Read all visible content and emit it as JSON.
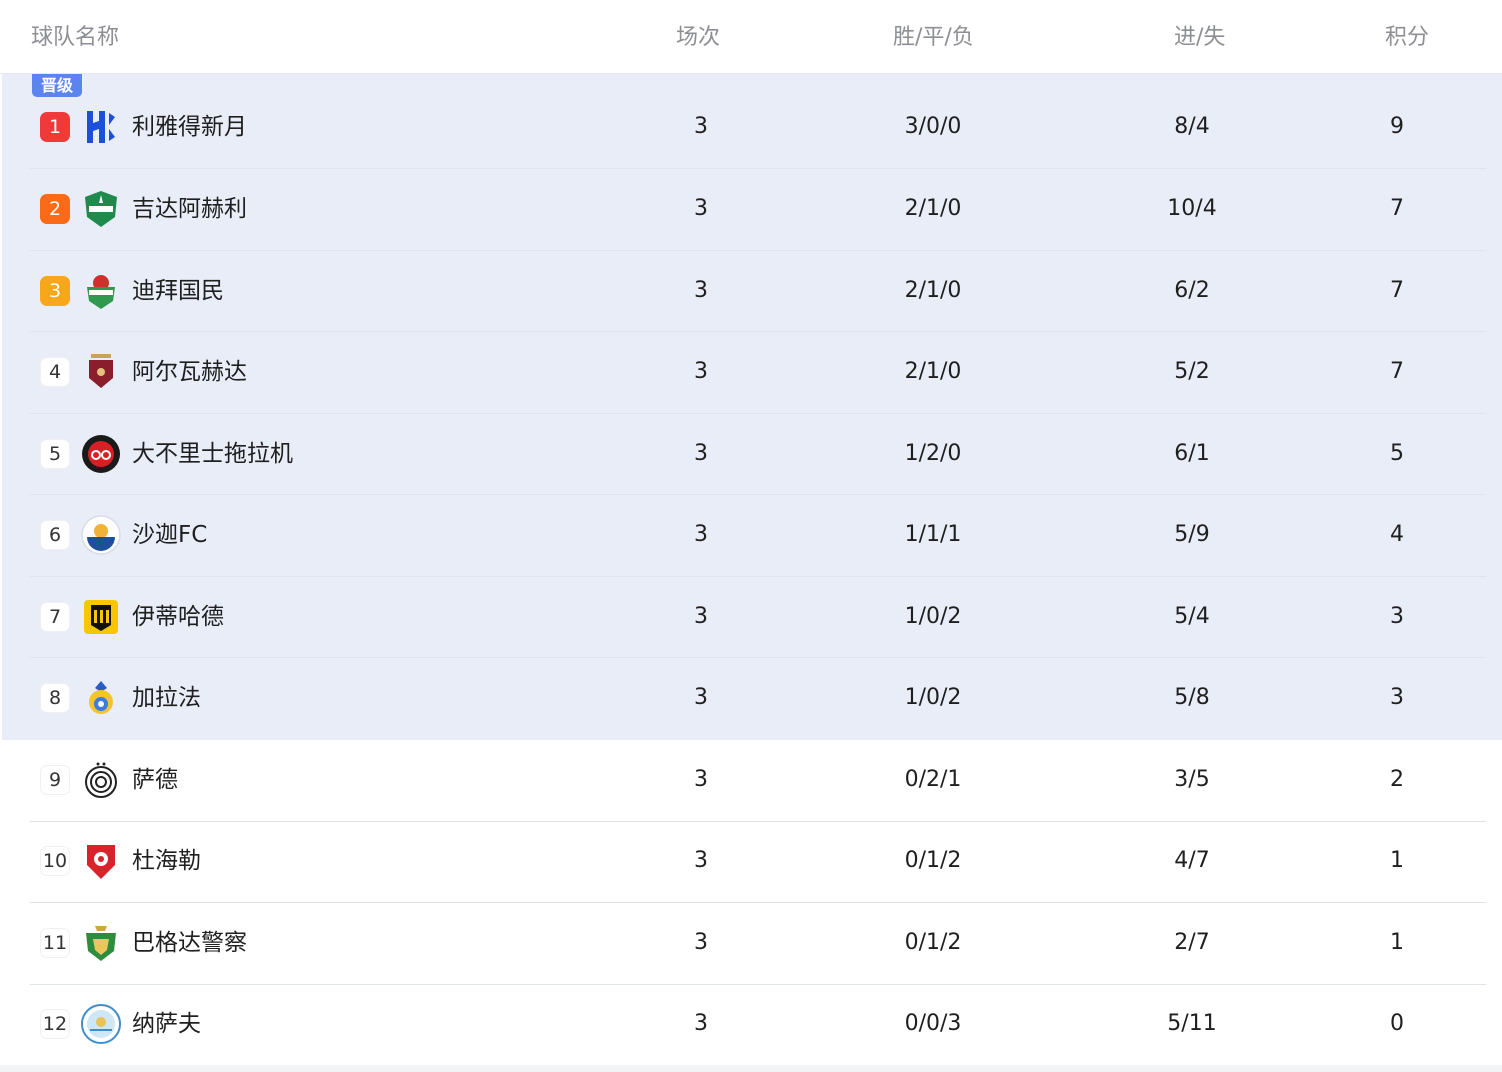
{
  "header": {
    "team": "球队名称",
    "played": "场次",
    "wdl": "胜/平/负",
    "goals": "进/失",
    "points": "积分"
  },
  "promotion_label": "晋级",
  "colors": {
    "promotion_bg": "#e8edf8",
    "promotion_badge": "#5b84ee",
    "rank1": "#f03a3a",
    "rank2": "#fb6a17",
    "rank3": "#f7a719"
  },
  "rows": [
    {
      "rank": "1",
      "team": "利雅得新月",
      "played": "3",
      "wdl": "3/0/0",
      "goals": "8/4",
      "points": "9",
      "logo": "al-hilal-crest-icon"
    },
    {
      "rank": "2",
      "team": "吉达阿赫利",
      "played": "3",
      "wdl": "2/1/0",
      "goals": "10/4",
      "points": "7",
      "logo": "al-ahli-crest-icon"
    },
    {
      "rank": "3",
      "team": "迪拜国民",
      "played": "3",
      "wdl": "2/1/0",
      "goals": "6/2",
      "points": "7",
      "logo": "shabab-al-ahli-crest-icon"
    },
    {
      "rank": "4",
      "team": "阿尔瓦赫达",
      "played": "3",
      "wdl": "2/1/0",
      "goals": "5/2",
      "points": "7",
      "logo": "al-wahda-crest-icon"
    },
    {
      "rank": "5",
      "team": "大不里士拖拉机",
      "played": "3",
      "wdl": "1/2/0",
      "goals": "6/1",
      "points": "5",
      "logo": "tractor-crest-icon"
    },
    {
      "rank": "6",
      "team": "沙迦FC",
      "played": "3",
      "wdl": "1/1/1",
      "goals": "5/9",
      "points": "4",
      "logo": "sharjah-crest-icon"
    },
    {
      "rank": "7",
      "team": "伊蒂哈德",
      "played": "3",
      "wdl": "1/0/2",
      "goals": "5/4",
      "points": "3",
      "logo": "al-ittihad-crest-icon"
    },
    {
      "rank": "8",
      "team": "加拉法",
      "played": "3",
      "wdl": "1/0/2",
      "goals": "5/8",
      "points": "3",
      "logo": "al-gharafa-crest-icon"
    },
    {
      "rank": "9",
      "team": "萨德",
      "played": "3",
      "wdl": "0/2/1",
      "goals": "3/5",
      "points": "2",
      "logo": "al-sadd-crest-icon"
    },
    {
      "rank": "10",
      "team": "杜海勒",
      "played": "3",
      "wdl": "0/1/2",
      "goals": "4/7",
      "points": "1",
      "logo": "al-duhail-crest-icon"
    },
    {
      "rank": "11",
      "team": "巴格达警察",
      "played": "3",
      "wdl": "0/1/2",
      "goals": "2/7",
      "points": "1",
      "logo": "al-shorta-crest-icon"
    },
    {
      "rank": "12",
      "team": "纳萨夫",
      "played": "3",
      "wdl": "0/0/3",
      "goals": "5/11",
      "points": "0",
      "logo": "nasaf-crest-icon"
    }
  ]
}
